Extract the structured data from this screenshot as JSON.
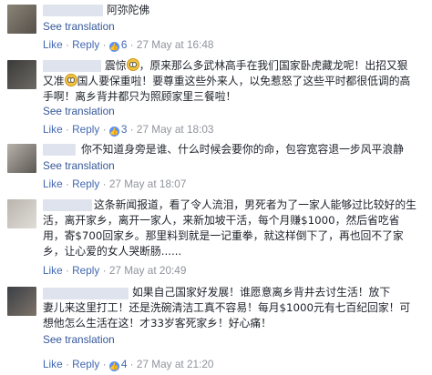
{
  "labels": {
    "see_translation": "See translation",
    "like": "Like",
    "reply": "Reply",
    "sep": "·"
  },
  "comments": [
    {
      "text": "阿弥陀佛",
      "likes": "6",
      "timestamp": "27 May at 16:48"
    },
    {
      "line1_prefix": "震惊",
      "line1_suffix": "，原来那么多武林高手在我们国家卧虎藏龙呢！出招又狠",
      "line2_prefix": "又准",
      "line2_suffix": "国人要保重啦！要尊重这些外来人，以免惹怒了这些平时都很低调的高",
      "line3": "手啊！离乡背井都只为照顾家里三餐啦！",
      "emoji": "scream-face-emoji",
      "likes": "3",
      "timestamp": "27 May at 18:03"
    },
    {
      "text": "你不知道身旁是谁、什么时候会要你的命，包容宽容退一步风平浪静",
      "timestamp": "27 May at 18:07"
    },
    {
      "line1": "这条新闻报道，看了令人流泪，男死者为了一家人能够过比较好的生",
      "line2": "活，离开家乡，离开一家人，来新加坡干活，每个月赚$1000，然后省吃省",
      "line3": "用，寄$700回家乡。那里料到就是一记重拳，就这样倒下了，再也回不了家",
      "line4": "乡，让心爱的女人哭断肠......",
      "timestamp": "27 May at 20:49"
    },
    {
      "line1": "如果自己国家好发展！谁愿意离乡背井去讨生活！放下",
      "line2": "妻儿来这里打工！还是洗碗清洁工真不容易！每月$1000元有七百纪回家！可",
      "line3": "想他怎么生活在这！才33岁客死家乡！好心痛！",
      "likes": "4",
      "timestamp": "27 May at 21:20"
    }
  ]
}
